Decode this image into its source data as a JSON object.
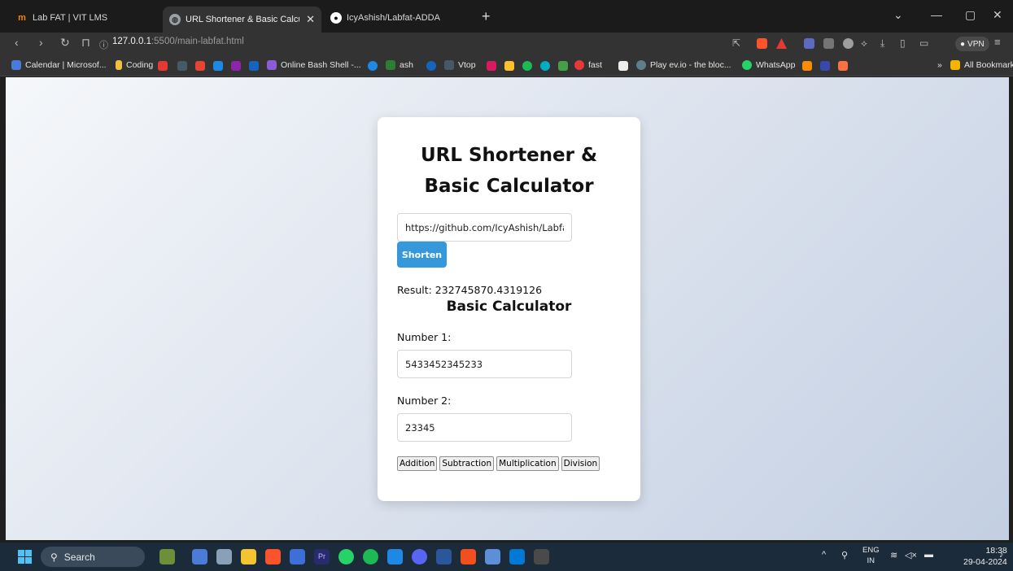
{
  "browser": {
    "tabs": [
      {
        "label": "Lab FAT | VIT LMS",
        "favicon": "moodle-icon",
        "active": false
      },
      {
        "label": "URL Shortener & Basic Calculato",
        "favicon": "globe-icon",
        "active": true
      },
      {
        "label": "IcyAshish/Labfat-ADDA",
        "favicon": "github-icon",
        "active": false
      }
    ],
    "new_tab": "+",
    "address": {
      "host": "127.0.0.1",
      "rest": ":5500/main-labfat.html"
    },
    "vpn_label": "VPN",
    "bookmarks": [
      {
        "label": "Calendar | Microsof...",
        "color": "#4a7bd6"
      },
      {
        "label": "Coding",
        "color": "#f0c040"
      },
      {
        "label": "Online Bash Shell -...",
        "color": "#8a5cd6"
      },
      {
        "label": "ash",
        "color": "#2e7d32"
      },
      {
        "label": "Vtop",
        "color": "#455a64"
      },
      {
        "label": "fast",
        "color": "#e53935"
      },
      {
        "label": "Play ev.io - the bloc...",
        "color": "#607d8b"
      },
      {
        "label": "WhatsApp",
        "color": "#25d366"
      },
      {
        "label": "»",
        "color": ""
      },
      {
        "label": "All Bookmarks",
        "color": "#f4b400"
      }
    ]
  },
  "page": {
    "title": "URL Shortener & Basic Calculator",
    "url_input_value": "https://github.com/IcyAshish/Labfa",
    "shorten_label": "Shorten",
    "result_text": "Result: 232745870.4319126",
    "calc_title": "Basic Calculator",
    "number1_label": "Number 1:",
    "number1_value": "5433452345233",
    "number2_label": "Number 2:",
    "number2_value": "23345",
    "ops": [
      "Addition",
      "Subtraction",
      "Multiplication",
      "Division"
    ],
    "colors": {
      "accent": "#3498db",
      "card": "#ffffff"
    }
  },
  "taskbar": {
    "search_label": "Search",
    "lang_top": "ENG",
    "lang_bottom": "IN",
    "time": "18:38",
    "date": "29-04-2024"
  }
}
